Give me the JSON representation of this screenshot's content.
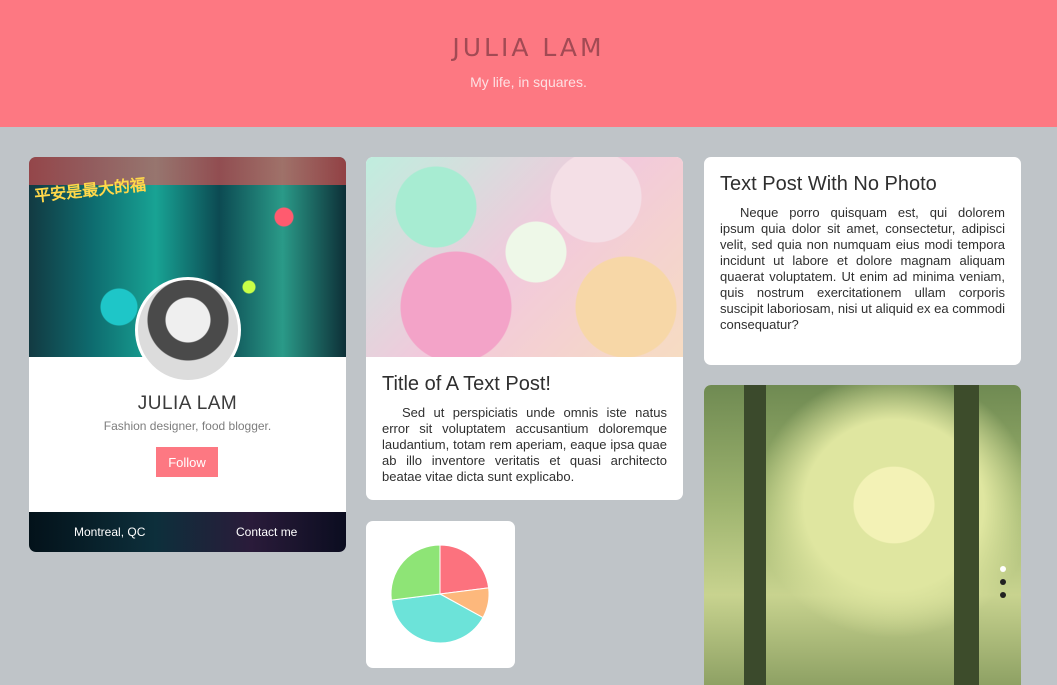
{
  "header": {
    "title": "JULIA LAM",
    "tagline": "My life, in squares."
  },
  "profile": {
    "name": "JULIA LAM",
    "bio": "Fashion designer, food blogger.",
    "follow_label": "Follow",
    "location": "Montreal, QC",
    "contact_label": "Contact me",
    "cover_sign_text": "平安是最大的福"
  },
  "post_with_photo": {
    "title": "Title of A Text Post!",
    "body": "Sed ut perspiciatis unde omnis iste natus error sit voluptatem accusantium doloremque laudantium, totam rem aperiam, eaque ipsa quae ab illo inventore veritatis et quasi architecto beatae vitae dicta sunt explicabo."
  },
  "post_no_photo": {
    "title": "Text Post With No Photo",
    "body": "Neque porro quisquam est, qui dolorem ipsum quia dolor sit amet, consectetur, adipisci velit, sed quia non numquam eius modi tempora incidunt ut labore et dolore magnam aliquam quaerat voluptatem. Ut enim ad minima veniam, quis nostrum exercitationem ullam corporis suscipit laboriosam, nisi ut aliquid ex ea commodi consequatur?"
  },
  "slider": {
    "slide_count": 3,
    "active_index": 0
  },
  "colors": {
    "accent": "#fd7882",
    "background": "#bfc4c8"
  },
  "chart_data": {
    "type": "pie",
    "slices": [
      {
        "value": 23,
        "color": "#fc727e"
      },
      {
        "value": 10,
        "color": "#fdb87c"
      },
      {
        "value": 40,
        "color": "#6ce3d9"
      },
      {
        "value": 27,
        "color": "#8ee476"
      }
    ]
  }
}
